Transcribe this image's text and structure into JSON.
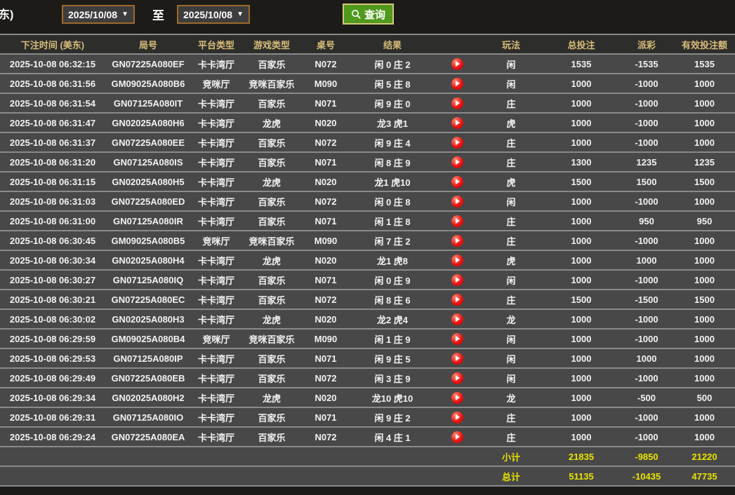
{
  "topbar": {
    "partial_label": "东)",
    "date_from": "2025/10/08",
    "to_label": "至",
    "date_to": "2025/10/08",
    "search_label": "查询"
  },
  "table": {
    "columns": [
      "下注时间 (美东)",
      "局号",
      "平台类型",
      "游戏类型",
      "桌号",
      "结果",
      "",
      "玩法",
      "总投注",
      "派彩",
      "有效投注额"
    ],
    "rows": [
      {
        "time": "2025-10-08 06:32:15",
        "game_no": "GN07225A080EF",
        "platform": "卡卡湾厅",
        "game_type": "百家乐",
        "table_no": "N072",
        "result": "闲 0 庄 2",
        "bet_side": "闲",
        "total_bet": "1535",
        "payout": "-1535",
        "payout_color": "green",
        "valid_bet": "1535"
      },
      {
        "time": "2025-10-08 06:31:56",
        "game_no": "GM09025A080B6",
        "platform": "竞咪厅",
        "game_type": "竞咪百家乐",
        "table_no": "M090",
        "result": "闲 5 庄 8",
        "bet_side": "闲",
        "total_bet": "1000",
        "payout": "-1000",
        "payout_color": "green",
        "valid_bet": "1000"
      },
      {
        "time": "2025-10-08 06:31:54",
        "game_no": "GN07125A080IT",
        "platform": "卡卡湾厅",
        "game_type": "百家乐",
        "table_no": "N071",
        "result": "闲 9 庄 0",
        "bet_side": "庄",
        "total_bet": "1000",
        "payout": "-1000",
        "payout_color": "green",
        "valid_bet": "1000"
      },
      {
        "time": "2025-10-08 06:31:47",
        "game_no": "GN02025A080H6",
        "platform": "卡卡湾厅",
        "game_type": "龙虎",
        "table_no": "N020",
        "result": "龙3 虎1",
        "bet_side": "虎",
        "total_bet": "1000",
        "payout": "-1000",
        "payout_color": "green",
        "valid_bet": "1000"
      },
      {
        "time": "2025-10-08 06:31:37",
        "game_no": "GN07225A080EE",
        "platform": "卡卡湾厅",
        "game_type": "百家乐",
        "table_no": "N072",
        "result": "闲 9 庄 4",
        "bet_side": "庄",
        "total_bet": "1000",
        "payout": "-1000",
        "payout_color": "green",
        "valid_bet": "1000"
      },
      {
        "time": "2025-10-08 06:31:20",
        "game_no": "GN07125A080IS",
        "platform": "卡卡湾厅",
        "game_type": "百家乐",
        "table_no": "N071",
        "result": "闲 8 庄 9",
        "bet_side": "庄",
        "total_bet": "1300",
        "payout": "1235",
        "payout_color": "red",
        "valid_bet": "1235"
      },
      {
        "time": "2025-10-08 06:31:15",
        "game_no": "GN02025A080H5",
        "platform": "卡卡湾厅",
        "game_type": "龙虎",
        "table_no": "N020",
        "result": "龙1 虎10",
        "bet_side": "虎",
        "total_bet": "1500",
        "payout": "1500",
        "payout_color": "red",
        "valid_bet": "1500"
      },
      {
        "time": "2025-10-08 06:31:03",
        "game_no": "GN07225A080ED",
        "platform": "卡卡湾厅",
        "game_type": "百家乐",
        "table_no": "N072",
        "result": "闲 0 庄 8",
        "bet_side": "闲",
        "total_bet": "1000",
        "payout": "-1000",
        "payout_color": "green",
        "valid_bet": "1000"
      },
      {
        "time": "2025-10-08 06:31:00",
        "game_no": "GN07125A080IR",
        "platform": "卡卡湾厅",
        "game_type": "百家乐",
        "table_no": "N071",
        "result": "闲 1 庄 8",
        "bet_side": "庄",
        "total_bet": "1000",
        "payout": "950",
        "payout_color": "red",
        "valid_bet": "950"
      },
      {
        "time": "2025-10-08 06:30:45",
        "game_no": "GM09025A080B5",
        "platform": "竞咪厅",
        "game_type": "竞咪百家乐",
        "table_no": "M090",
        "result": "闲 7 庄 2",
        "bet_side": "庄",
        "total_bet": "1000",
        "payout": "-1000",
        "payout_color": "green",
        "valid_bet": "1000"
      },
      {
        "time": "2025-10-08 06:30:34",
        "game_no": "GN02025A080H4",
        "platform": "卡卡湾厅",
        "game_type": "龙虎",
        "table_no": "N020",
        "result": "龙1 虎8",
        "bet_side": "虎",
        "total_bet": "1000",
        "payout": "1000",
        "payout_color": "red",
        "valid_bet": "1000"
      },
      {
        "time": "2025-10-08 06:30:27",
        "game_no": "GN07125A080IQ",
        "platform": "卡卡湾厅",
        "game_type": "百家乐",
        "table_no": "N071",
        "result": "闲 0 庄 9",
        "bet_side": "闲",
        "total_bet": "1000",
        "payout": "-1000",
        "payout_color": "green",
        "valid_bet": "1000"
      },
      {
        "time": "2025-10-08 06:30:21",
        "game_no": "GN07225A080EC",
        "platform": "卡卡湾厅",
        "game_type": "百家乐",
        "table_no": "N072",
        "result": "闲 8 庄 6",
        "bet_side": "庄",
        "total_bet": "1500",
        "payout": "-1500",
        "payout_color": "green",
        "valid_bet": "1500"
      },
      {
        "time": "2025-10-08 06:30:02",
        "game_no": "GN02025A080H3",
        "platform": "卡卡湾厅",
        "game_type": "龙虎",
        "table_no": "N020",
        "result": "龙2 虎4",
        "bet_side": "龙",
        "total_bet": "1000",
        "payout": "-1000",
        "payout_color": "green",
        "valid_bet": "1000"
      },
      {
        "time": "2025-10-08 06:29:59",
        "game_no": "GM09025A080B4",
        "platform": "竞咪厅",
        "game_type": "竞咪百家乐",
        "table_no": "M090",
        "result": "闲 1 庄 9",
        "bet_side": "闲",
        "total_bet": "1000",
        "payout": "-1000",
        "payout_color": "green",
        "valid_bet": "1000"
      },
      {
        "time": "2025-10-08 06:29:53",
        "game_no": "GN07125A080IP",
        "platform": "卡卡湾厅",
        "game_type": "百家乐",
        "table_no": "N071",
        "result": "闲 9 庄 5",
        "bet_side": "闲",
        "total_bet": "1000",
        "payout": "1000",
        "payout_color": "red",
        "valid_bet": "1000"
      },
      {
        "time": "2025-10-08 06:29:49",
        "game_no": "GN07225A080EB",
        "platform": "卡卡湾厅",
        "game_type": "百家乐",
        "table_no": "N072",
        "result": "闲 3 庄 9",
        "bet_side": "闲",
        "total_bet": "1000",
        "payout": "-1000",
        "payout_color": "green",
        "valid_bet": "1000"
      },
      {
        "time": "2025-10-08 06:29:34",
        "game_no": "GN02025A080H2",
        "platform": "卡卡湾厅",
        "game_type": "龙虎",
        "table_no": "N020",
        "result": "龙10 虎10",
        "bet_side": "龙",
        "total_bet": "1000",
        "payout": "-500",
        "payout_color": "green",
        "valid_bet": "500"
      },
      {
        "time": "2025-10-08 06:29:31",
        "game_no": "GN07125A080IO",
        "platform": "卡卡湾厅",
        "game_type": "百家乐",
        "table_no": "N071",
        "result": "闲 9 庄 2",
        "bet_side": "庄",
        "total_bet": "1000",
        "payout": "-1000",
        "payout_color": "green",
        "valid_bet": "1000"
      },
      {
        "time": "2025-10-08 06:29:24",
        "game_no": "GN07225A080EA",
        "platform": "卡卡湾厅",
        "game_type": "百家乐",
        "table_no": "N072",
        "result": "闲 4 庄 1",
        "bet_side": "庄",
        "total_bet": "1000",
        "payout": "-1000",
        "payout_color": "green",
        "valid_bet": "1000"
      }
    ],
    "subtotal": {
      "label": "小计",
      "total_bet": "21835",
      "payout": "-9850",
      "valid_bet": "21220"
    },
    "total": {
      "label": "总计",
      "total_bet": "51135",
      "payout": "-10435",
      "valid_bet": "47735"
    }
  },
  "colors": {
    "search_button_bg": "#4f9a1c",
    "search_button_border": "#d9c57e",
    "date_border": "#9c6a2c",
    "header_text": "#d8bc7a",
    "payout_loss_green": "#5cd60a",
    "payout_win_red": "#a50f22",
    "footer_yellow": "#e9e300",
    "play_button_red": "#ea1010"
  }
}
